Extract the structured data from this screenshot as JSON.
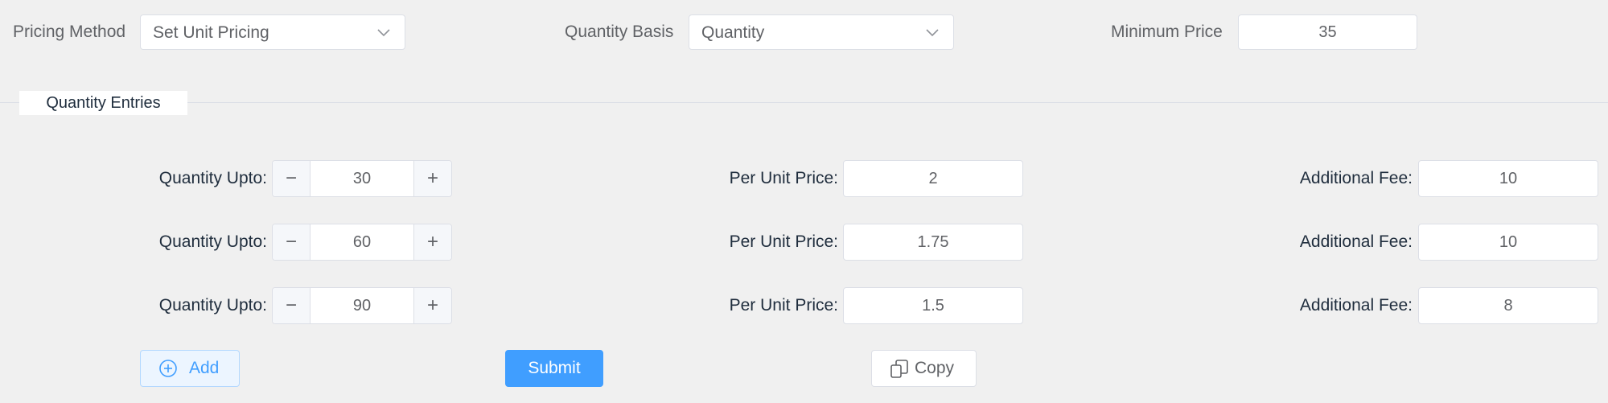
{
  "header": {
    "pricing_method": {
      "label": "Pricing Method",
      "value": "Set Unit Pricing",
      "icon": "chevron-down-icon"
    },
    "quantity_basis": {
      "label": "Quantity Basis",
      "value": "Quantity",
      "icon": "chevron-down-icon"
    },
    "minimum_price": {
      "label": "Minimum Price",
      "value": "35"
    }
  },
  "section": {
    "title": "Quantity Entries"
  },
  "entries": [
    {
      "qty_label": "Quantity Upto:",
      "qty": "30",
      "price_label": "Per Unit Price:",
      "price": "2",
      "fee_label": "Additional Fee:",
      "fee": "10"
    },
    {
      "qty_label": "Quantity Upto:",
      "qty": "60",
      "price_label": "Per Unit Price:",
      "price": "1.75",
      "fee_label": "Additional Fee:",
      "fee": "10"
    },
    {
      "qty_label": "Quantity Upto:",
      "qty": "90",
      "price_label": "Per Unit Price:",
      "price": "1.5",
      "fee_label": "Additional Fee:",
      "fee": "8"
    }
  ],
  "stepper": {
    "minus": "−",
    "plus": "+"
  },
  "actions": {
    "add_label": "Add",
    "add_icon": "plus-circle-icon",
    "submit_label": "Submit",
    "copy_label": "Copy",
    "copy_icon": "copy-icon"
  },
  "colors": {
    "primary": "#409eff",
    "background": "#f0f0f0"
  }
}
